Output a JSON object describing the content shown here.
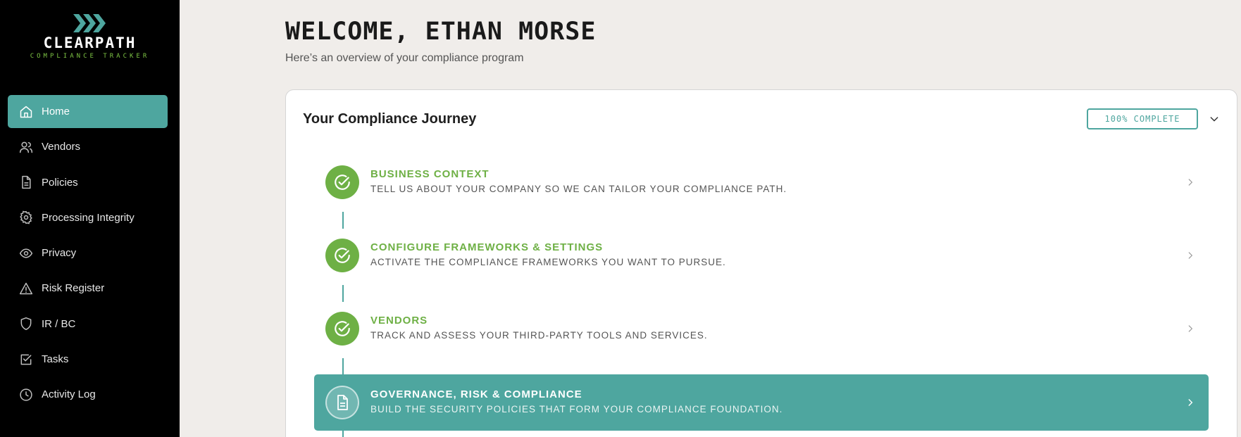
{
  "brand": {
    "name": "CLEARPATH",
    "tagline": "COMPLIANCE TRACKER",
    "accent": "#4ea69f",
    "green": "#6eb045"
  },
  "sidebar": {
    "items": [
      {
        "label": "Home",
        "icon": "home-icon",
        "active": true
      },
      {
        "label": "Vendors",
        "icon": "users-icon",
        "active": false
      },
      {
        "label": "Policies",
        "icon": "document-icon",
        "active": false
      },
      {
        "label": "Processing Integrity",
        "icon": "gear-icon",
        "active": false
      },
      {
        "label": "Privacy",
        "icon": "eye-icon",
        "active": false
      },
      {
        "label": "Risk Register",
        "icon": "warning-icon",
        "active": false
      },
      {
        "label": "IR / BC",
        "icon": "shield-icon",
        "active": false
      },
      {
        "label": "Tasks",
        "icon": "checkbox-icon",
        "active": false
      },
      {
        "label": "Activity Log",
        "icon": "clock-icon",
        "active": false
      }
    ]
  },
  "header": {
    "welcome": "WELCOME, ETHAN MORSE",
    "subtitle": "Here’s an overview of your compliance program"
  },
  "journey": {
    "title": "Your Compliance Journey",
    "badge": "100% COMPLETE",
    "steps": [
      {
        "title": "BUSINESS CONTEXT",
        "description": "TELL US ABOUT YOUR COMPANY SO WE CAN TAILOR YOUR COMPLIANCE PATH.",
        "status": "complete",
        "icon": "check-circle-icon"
      },
      {
        "title": "CONFIGURE FRAMEWORKS & SETTINGS",
        "description": "ACTIVATE THE COMPLIANCE FRAMEWORKS YOU WANT TO PURSUE.",
        "status": "complete",
        "icon": "check-circle-icon"
      },
      {
        "title": "VENDORS",
        "description": "TRACK AND ASSESS YOUR THIRD-PARTY TOOLS AND SERVICES.",
        "status": "complete",
        "icon": "check-circle-icon"
      },
      {
        "title": "GOVERNANCE, RISK & COMPLIANCE",
        "description": "BUILD THE SECURITY POLICIES THAT FORM YOUR COMPLIANCE FOUNDATION.",
        "status": "current",
        "icon": "document-icon"
      }
    ]
  }
}
